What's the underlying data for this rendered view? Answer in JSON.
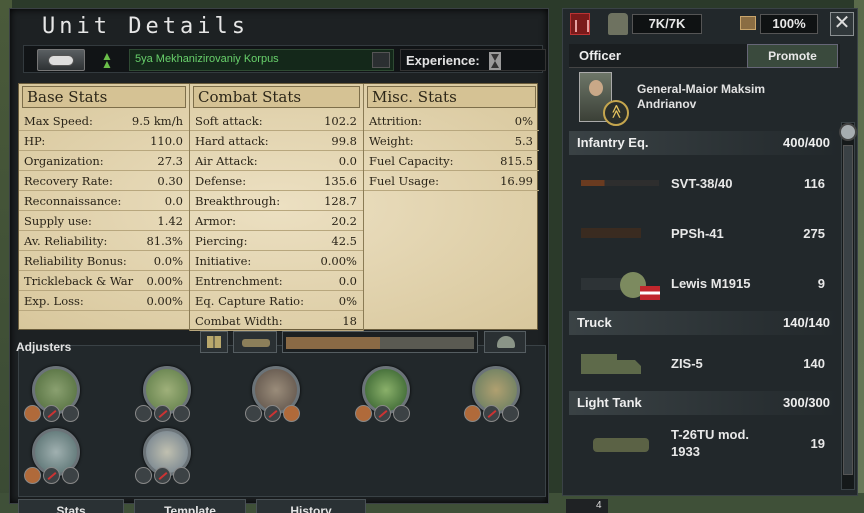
{
  "window": {
    "title": "Unit Details",
    "close_symbol": "✕"
  },
  "unit": {
    "name": "5ya Mekhanizirovaniy Korpus",
    "experience_label": "Experience:"
  },
  "stats": {
    "base": {
      "heading": "Base Stats",
      "rows": [
        {
          "label": "Max Speed:",
          "value": "9.5 km/h"
        },
        {
          "label": "HP:",
          "value": "110.0"
        },
        {
          "label": "Organization:",
          "value": "27.3"
        },
        {
          "label": "Recovery Rate:",
          "value": "0.30"
        },
        {
          "label": "Reconnaissance:",
          "value": "0.0"
        },
        {
          "label": "Supply use:",
          "value": "1.42"
        },
        {
          "label": "Av. Reliability:",
          "value": "81.3%"
        },
        {
          "label": "Reliability Bonus:",
          "value": "0.0%"
        },
        {
          "label": "Trickleback & War",
          "value": "0.00%"
        },
        {
          "label": "Exp. Loss:",
          "value": "0.00%"
        }
      ]
    },
    "combat": {
      "heading": "Combat Stats",
      "rows": [
        {
          "label": "Soft attack:",
          "value": "102.2"
        },
        {
          "label": "Hard attack:",
          "value": "99.8"
        },
        {
          "label": "Air Attack:",
          "value": "0.0"
        },
        {
          "label": "Defense:",
          "value": "135.6"
        },
        {
          "label": "Breakthrough:",
          "value": "128.7"
        },
        {
          "label": "Armor:",
          "value": "20.2"
        },
        {
          "label": "Piercing:",
          "value": "42.5"
        },
        {
          "label": "Initiative:",
          "value": "0.00%"
        },
        {
          "label": "Entrenchment:",
          "value": "0.0"
        },
        {
          "label": "Eq. Capture Ratio:",
          "value": "0%"
        },
        {
          "label": "Combat Width:",
          "value": "18"
        }
      ]
    },
    "misc": {
      "heading": "Misc. Stats",
      "rows": [
        {
          "label": "Attrition:",
          "value": "0%"
        },
        {
          "label": "Weight:",
          "value": "5.3"
        },
        {
          "label": "Fuel Capacity:",
          "value": "815.5"
        },
        {
          "label": "Fuel Usage:",
          "value": "16.99"
        }
      ]
    }
  },
  "adjusters": {
    "label": "Adjusters",
    "supply_bar_fraction": 0.5
  },
  "bottom_tabs": [
    "Stats",
    "Template",
    "History"
  ],
  "header": {
    "manpower": "7K/7K",
    "equipment_pct": "100%"
  },
  "officer": {
    "label": "Officer",
    "promote_label": "Promote",
    "name": "General-Maior Maksim Andrianov"
  },
  "equipment": {
    "infantry": {
      "name": "Infantry Eq.",
      "count": "400/400",
      "items": [
        {
          "name": "SVT-38/40",
          "qty": "116"
        },
        {
          "name": "PPSh-41",
          "qty": "275"
        },
        {
          "name": "Lewis M1915",
          "qty": "9"
        }
      ]
    },
    "truck": {
      "name": "Truck",
      "count": "140/140",
      "items": [
        {
          "name": "ZIS-5",
          "qty": "140"
        }
      ]
    },
    "light_tank": {
      "name": "Light Tank",
      "count": "300/300",
      "items": [
        {
          "name": "T-26TU mod. 1933",
          "qty": "19"
        }
      ]
    }
  },
  "bottom_badge": "4",
  "colors": {
    "parchment": "#e4d6b2",
    "unit_name_green": "#68d06b",
    "panel_dark": "#22282b"
  }
}
